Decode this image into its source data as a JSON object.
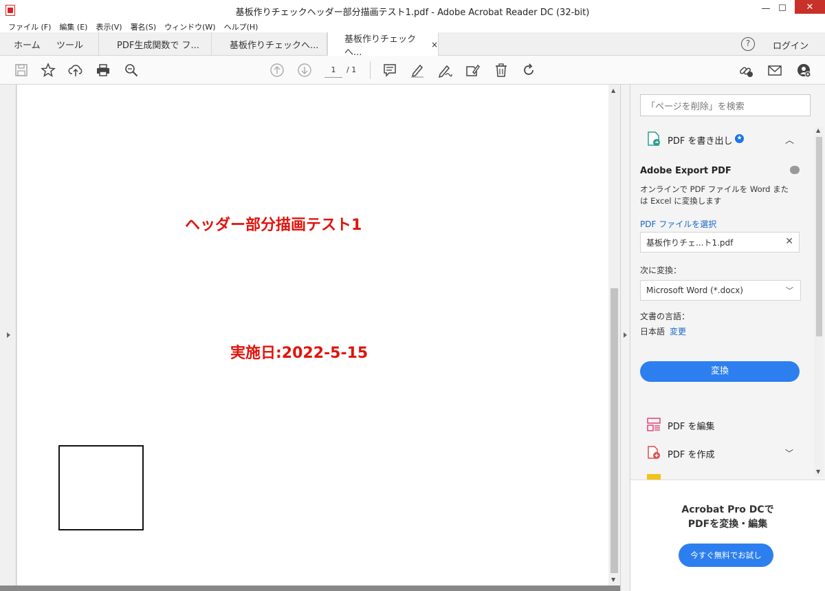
{
  "window": {
    "title": "基板作りチェックヘッダー部分描画テスト1.pdf - Adobe Acrobat Reader DC (32-bit)",
    "min": "—",
    "max": "☐",
    "close": "✕"
  },
  "menu": [
    "ファイル (F)",
    "編集 (E)",
    "表示(V)",
    "署名(S)",
    "ウィンドウ(W)",
    "ヘルプ(H)"
  ],
  "tabs": {
    "home": "ホーム",
    "tools": "ツール",
    "doc1": "PDF生成関数で フ...",
    "doc2": "基板作りチェックへ...",
    "doc3": "基板作りチェックへ...",
    "close": "×",
    "help": "?",
    "login": "ログイン"
  },
  "toolbar": {
    "page_current": "1",
    "page_total": "/ 1"
  },
  "document": {
    "heading": "ヘッダー部分描画テスト1",
    "date": "実施日:2022-5-15"
  },
  "panel": {
    "search_placeholder": "「ページを削除」を検索",
    "export_section": "PDF を書き出し",
    "export_title": "Adobe Export PDF",
    "export_desc": "オンラインで PDF ファイルを Word または Excel に変換します",
    "select_file": "PDF ファイルを選択",
    "file_name": "基板作りチェ...ト1.pdf",
    "convert_to_label": "次に変換：",
    "convert_format": "Microsoft Word (*.docx)",
    "doc_lang_label": "文書の言語：",
    "doc_lang": "日本語",
    "change": "変更",
    "convert_button": "変換",
    "edit_pdf": "PDF を編集",
    "create_pdf": "PDF を作成",
    "promo_line1": "Acrobat Pro DCで",
    "promo_line2": "PDFを変換・編集",
    "trial_button": "今すぐ無料でお試し"
  },
  "colors": {
    "accent": "#2d7ff0",
    "heading_red": "#e0140c",
    "close_red": "#c8302a"
  }
}
